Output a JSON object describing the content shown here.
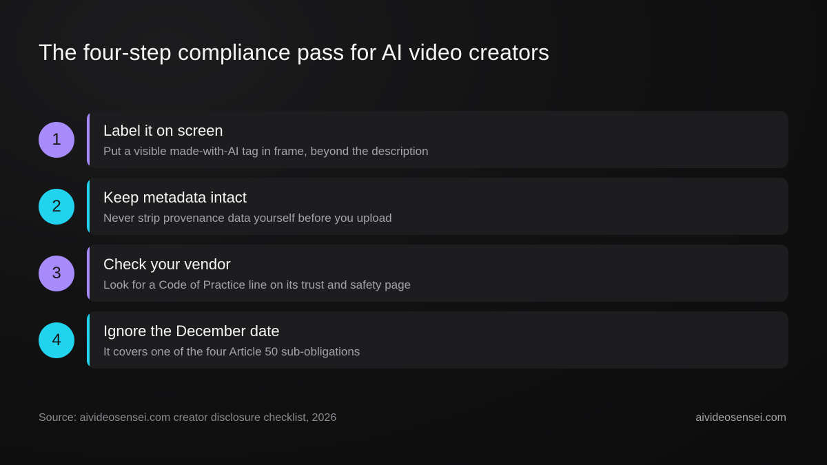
{
  "title": "The four-step compliance pass for AI video creators",
  "colors": {
    "purple": "#a78bfa",
    "cyan": "#22d3ee",
    "card_bg": "#1d1d1f"
  },
  "steps": [
    {
      "number": "1",
      "title": "Label it on screen",
      "description": "Put a visible made-with-AI tag in frame, beyond the description",
      "color": "#a78bfa"
    },
    {
      "number": "2",
      "title": "Keep metadata intact",
      "description": "Never strip provenance data yourself before you upload",
      "color": "#22d3ee"
    },
    {
      "number": "3",
      "title": "Check your vendor",
      "description": "Look for a Code of Practice line on its trust and safety page",
      "color": "#a78bfa"
    },
    {
      "number": "4",
      "title": "Ignore the December date",
      "description": "It covers one of the four Article 50 sub-obligations",
      "color": "#22d3ee"
    }
  ],
  "footer": {
    "source": "Source: aivideosensei.com creator disclosure checklist, 2026",
    "site": "aivideosensei.com"
  }
}
